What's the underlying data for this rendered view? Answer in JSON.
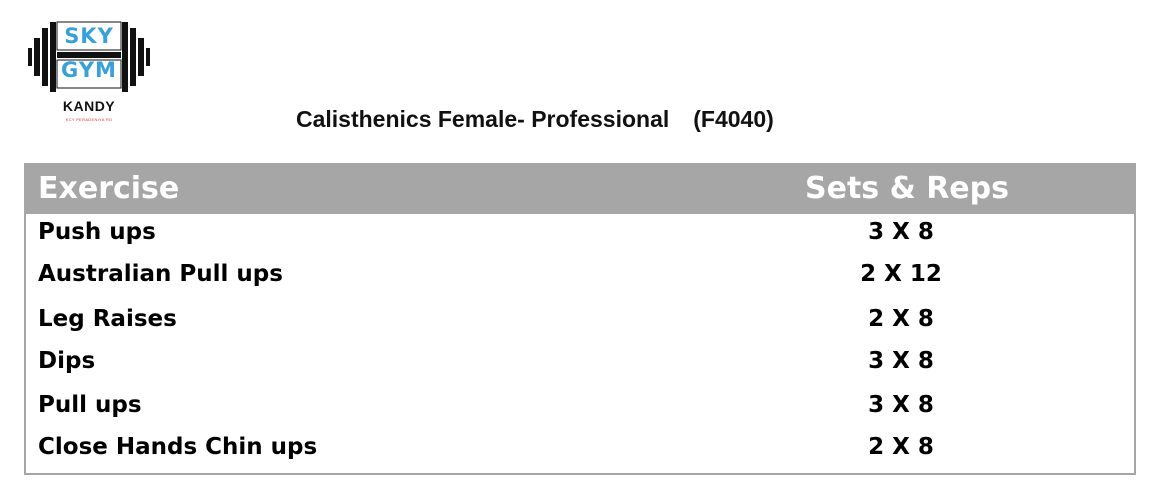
{
  "logo": {
    "word1": "SKY",
    "word2": "GYM",
    "city": "KANDY",
    "tagline": "KCY PERADENIYA RD",
    "icon": "dumbbell-icon",
    "accent_color": "#3aa0d8"
  },
  "title": {
    "text": "Calisthenics Female- Professional",
    "code": "(F4040)"
  },
  "table": {
    "header_color": "#a6a6a6",
    "columns": [
      "Exercise",
      "Sets & Reps"
    ],
    "rows": [
      {
        "exercise": "Push ups",
        "sets_reps": "3 X 8"
      },
      {
        "exercise": "Australian Pull ups",
        "sets_reps": "2 X 12"
      },
      {
        "exercise": "Leg Raises",
        "sets_reps": "2 X 8"
      },
      {
        "exercise": "Dips",
        "sets_reps": "3 X 8"
      },
      {
        "exercise": "Pull ups",
        "sets_reps": "3 X 8"
      },
      {
        "exercise": "Close Hands Chin ups",
        "sets_reps": "2 X 8"
      }
    ]
  }
}
